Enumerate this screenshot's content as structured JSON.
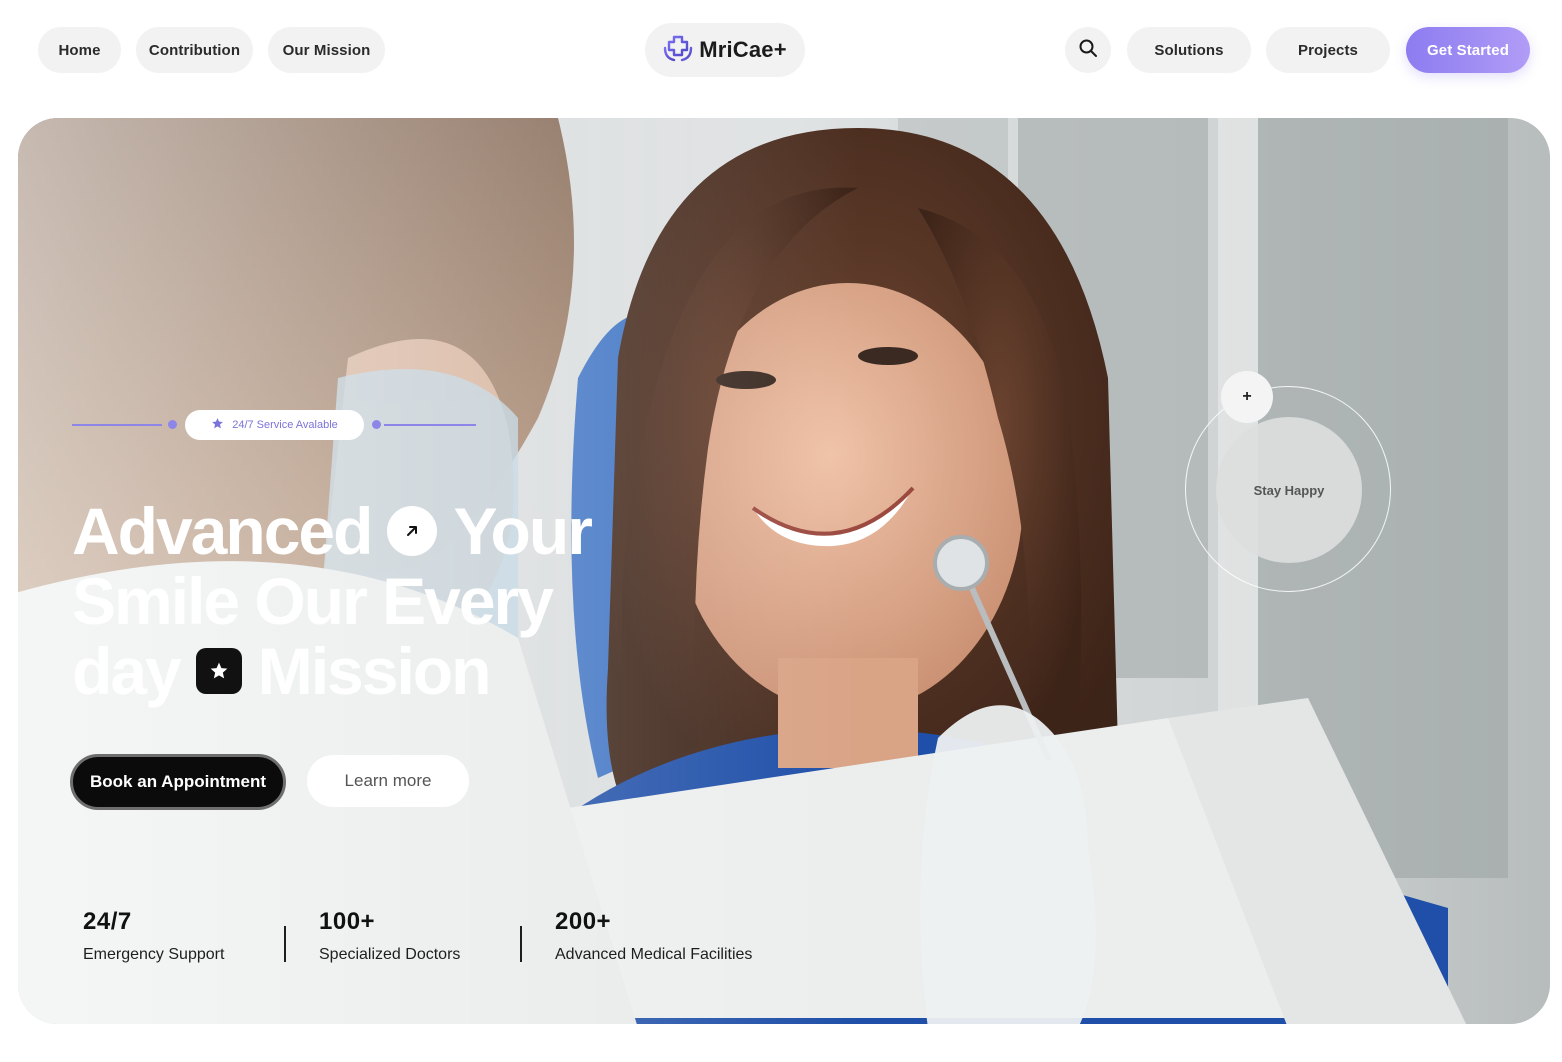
{
  "nav": {
    "left_links": [
      "Home",
      "Contribution",
      "Our Mission"
    ],
    "logo_text": "MriCae+",
    "right_links": [
      "Solutions",
      "Projects"
    ],
    "cta_label": "Get Started"
  },
  "hero": {
    "badge_text": "24/7 Service Avalable",
    "headline": {
      "line1_a": "Advanced",
      "line1_b": "Your",
      "line2": "Smile Our Every",
      "line3_a": "day",
      "line3_b": "Mission"
    },
    "primary_button": "Book an Appointment",
    "secondary_button": "Learn more",
    "stay_plus": "+",
    "stay_label": "Stay Happy",
    "stats": [
      {
        "value": "24/7",
        "label": "Emergency Support"
      },
      {
        "value": "100+",
        "label": "Specialized Doctors"
      },
      {
        "value": "200+",
        "label": "Advanced Medical Facilities"
      }
    ]
  },
  "colors": {
    "accent": "#8c7cf0",
    "accent_light": "#b19cf6",
    "nav_pill": "#f2f2f3",
    "primary_button": "#0b0b0b"
  },
  "icons": [
    "search-icon",
    "logo-hands-icon",
    "star-icon",
    "arrow-up-right-icon"
  ]
}
